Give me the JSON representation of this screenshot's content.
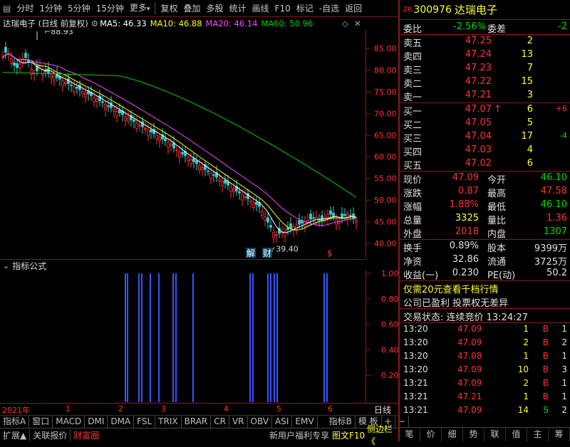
{
  "toolbar": {
    "items": [
      "分时",
      "1分钟",
      "5分钟",
      "15分钟",
      "更多",
      "复权",
      "叠加",
      "多股",
      "统计",
      "画线",
      "F10",
      "标记",
      "-自选",
      "返回"
    ]
  },
  "chart": {
    "title": "达瑞电子 (日线 前复权)",
    "ma5_label": "MA5: 46.33",
    "ma10_label": "MA10: 46.88",
    "ma20_label": "MA20: 46.14",
    "ma60_label": "MA60: 50.96",
    "high_mark": "88.93",
    "low_mark": "39.40",
    "yticks": [
      "85.00",
      "80.00",
      "75.00",
      "70.00",
      "65.00",
      "60.00",
      "55.00",
      "50.00",
      "45.00",
      "40.00"
    ],
    "event_labels": [
      "解",
      "财",
      "$"
    ],
    "colors": {
      "ma5": "#ffffff",
      "ma10": "#ffff00",
      "ma20": "#ff44ff",
      "ma60": "#00cc00",
      "up": "#ff3333",
      "down": "#33cccc"
    }
  },
  "indicator": {
    "title": "指标公式",
    "yticks": [
      "1.00",
      "0.80",
      "0.60",
      "0.40",
      "0.20"
    ],
    "bar_color": "#3355ff"
  },
  "xaxis": {
    "labels": [
      "2021年",
      "1",
      "2",
      "3",
      "4",
      "5",
      "6"
    ],
    "period": "日线"
  },
  "bottom_tabs": [
    "指标A",
    "窗口",
    "MACD",
    "DMI",
    "DMA",
    "FSL",
    "TRIX",
    "BRAR",
    "CR",
    "VR",
    "OBV",
    "ASI",
    "EMV",
    "指标B",
    "模 板",
    "+",
    "−"
  ],
  "status_bar": {
    "expand": "扩展▲",
    "related": "关联报价",
    "wealth": "财富圈",
    "promo": "新用户福利专享",
    "f10": "图文F10",
    "sidebar": "侧边栏《"
  },
  "stock": {
    "code_prefix": "ZR",
    "code": "300976",
    "name": "达瑞电子"
  },
  "weibi": {
    "label": "委比",
    "value": "-2.56%",
    "label2": "委差",
    "value2": "-2"
  },
  "asks": [
    {
      "label": "卖五",
      "price": "47.25",
      "vol": "2"
    },
    {
      "label": "卖四",
      "price": "47.24",
      "vol": "13"
    },
    {
      "label": "卖三",
      "price": "47.23",
      "vol": "7"
    },
    {
      "label": "卖二",
      "price": "47.22",
      "vol": "15"
    },
    {
      "label": "卖一",
      "price": "47.21",
      "vol": "3"
    }
  ],
  "bids": [
    {
      "label": "买一",
      "price": "47.07",
      "vol": "6",
      "chg": "+6",
      "arrow": "↑"
    },
    {
      "label": "买二",
      "price": "47.05",
      "vol": "5",
      "chg": "",
      "arrow": ""
    },
    {
      "label": "买三",
      "price": "47.04",
      "vol": "17",
      "chg": "-4",
      "arrow": ""
    },
    {
      "label": "买四",
      "price": "47.03",
      "vol": "4",
      "chg": "",
      "arrow": ""
    },
    {
      "label": "买五",
      "price": "47.02",
      "vol": "6",
      "chg": "",
      "arrow": ""
    }
  ],
  "quote": [
    {
      "l1": "现价",
      "v1": "47.09",
      "l2": "今开",
      "v2": "46.10"
    },
    {
      "l1": "涨跌",
      "v1": "0.87",
      "l2": "最高",
      "v2": "47.58"
    },
    {
      "l1": "涨幅",
      "v1": "1.88%",
      "l2": "最低",
      "v2": "46.10"
    },
    {
      "l1": "总量",
      "v1": "3325",
      "l2": "量比",
      "v2": "1.36"
    },
    {
      "l1": "外盘",
      "v1": "2018",
      "l2": "内盘",
      "v2": "1307"
    }
  ],
  "fund": [
    {
      "l1": "换手",
      "v1": "0.89%",
      "l2": "股本",
      "v2": "9399万"
    },
    {
      "l1": "净资",
      "v1": "32.86",
      "l2": "流通",
      "v2": "3725万"
    },
    {
      "l1": "收益(一)",
      "v1": "0.230",
      "l2": "PE(动)",
      "v2": "50.2"
    }
  ],
  "promo_line": "仅需20元查看千档行情",
  "notice_line": "公司已盈利 投票权无差异",
  "trade_status": "交易状态: 连续竞价 13:24:27",
  "ticks": [
    {
      "time": "13:20",
      "price": "47.09",
      "vol": "1",
      "side": "B",
      "num": "1"
    },
    {
      "time": "13:20",
      "price": "47.09",
      "vol": "2",
      "side": "B",
      "num": "2"
    },
    {
      "time": "13:20",
      "price": "47.08",
      "vol": "1",
      "side": "B",
      "num": "1"
    },
    {
      "time": "13:20",
      "price": "47.09",
      "vol": "10",
      "side": "B",
      "num": "3"
    },
    {
      "time": "13:21",
      "price": "47.09",
      "vol": "2",
      "side": "B",
      "num": "1"
    },
    {
      "time": "13:21",
      "price": "47.21",
      "vol": "1",
      "side": "B",
      "num": "1"
    },
    {
      "time": "13:21",
      "price": "47.09",
      "vol": "14",
      "side": "S",
      "num": "2"
    }
  ],
  "right_tabs": [
    "笔",
    "价",
    "细",
    "势",
    "联",
    "值",
    "主",
    "筹"
  ]
}
